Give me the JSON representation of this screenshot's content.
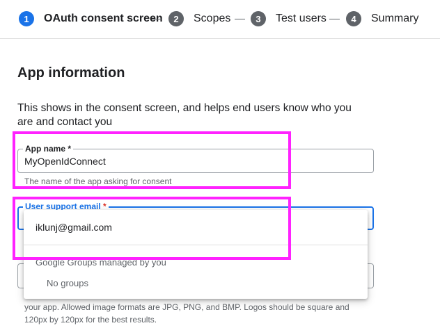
{
  "stepper": {
    "steps": [
      {
        "number": "1",
        "label": "OAuth consent screen",
        "state": "active"
      },
      {
        "number": "2",
        "label": "Scopes",
        "state": "pending"
      },
      {
        "number": "3",
        "label": "Test users",
        "state": "pending"
      },
      {
        "number": "4",
        "label": "Summary",
        "state": "pending"
      }
    ],
    "colors": {
      "active": "#1a73e8",
      "pending": "#5f6368"
    }
  },
  "app_information": {
    "title": "App information",
    "description": "This shows in the consent screen, and helps end users know who you are and contact you",
    "app_name": {
      "label": "App name *",
      "value": "MyOpenIdConnect",
      "hint": "The name of the app asking for consent"
    },
    "user_support_email": {
      "label": "User support email",
      "required_marker": "*",
      "dropdown": {
        "selected_option": "iklunj@gmail.com",
        "group_heading": "Google Groups managed by you",
        "empty_text": "No groups"
      }
    },
    "logo_help_text": "your app. Allowed image formats are JPG, PNG, and BMP. Logos should be square and 120px by 120px for the best results."
  },
  "annotation": {
    "highlight_color": "#ff22ff"
  }
}
